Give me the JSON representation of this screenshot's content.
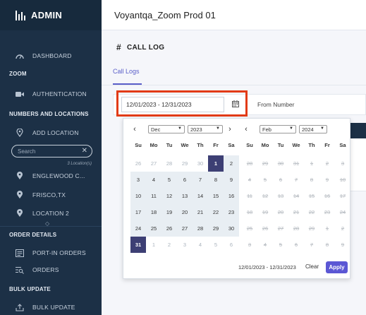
{
  "sidebar": {
    "brand": "ADMIN",
    "items": [
      {
        "label": "DASHBOARD",
        "icon": "gauge-icon"
      },
      {
        "label": "AUTHENTICATION",
        "icon": "video-icon"
      },
      {
        "label": "ADD LOCATION",
        "icon": "map-pin-icon"
      },
      {
        "label": "ENGLEWOOD C...",
        "icon": "map-pin-icon"
      },
      {
        "label": "FRISCO,TX",
        "icon": "map-pin-icon"
      },
      {
        "label": "LOCATION 2",
        "icon": "map-pin-icon"
      },
      {
        "label": "PORT-IN ORDERS",
        "icon": "list-icon"
      },
      {
        "label": "ORDERS",
        "icon": "search-list-icon"
      },
      {
        "label": "BULK UPDATE",
        "icon": "upload-icon"
      }
    ],
    "sections": {
      "zoom": "ZOOM",
      "numbers": "NUMBERS AND LOCATIONS",
      "order_details": "ORDER DETAILS",
      "bulk_update": "BULK UPDATE"
    },
    "search": {
      "placeholder": "Search"
    },
    "location_count": "3 Location(s)"
  },
  "header": {
    "title": "Voyantqa_Zoom Prod 01"
  },
  "page": {
    "title": "CALL LOG",
    "tab": "Call Logs",
    "date_range_value": "12/01/2023 - 12/31/2023",
    "from_number_label": "From Number"
  },
  "picker": {
    "weekdays": [
      "Su",
      "Mo",
      "Tu",
      "We",
      "Th",
      "Fr",
      "Sa"
    ],
    "left": {
      "month": "Dec",
      "year": "2023",
      "weeks": [
        [
          "26",
          "27",
          "28",
          "29",
          "30",
          "1",
          "2"
        ],
        [
          "3",
          "4",
          "5",
          "6",
          "7",
          "8",
          "9"
        ],
        [
          "10",
          "11",
          "12",
          "13",
          "14",
          "15",
          "16"
        ],
        [
          "17",
          "18",
          "19",
          "20",
          "21",
          "22",
          "23"
        ],
        [
          "24",
          "25",
          "26",
          "27",
          "28",
          "29",
          "30"
        ],
        [
          "31",
          "1",
          "2",
          "3",
          "4",
          "5",
          "6"
        ]
      ]
    },
    "right": {
      "month": "Feb",
      "year": "2024",
      "weeks": [
        [
          "28",
          "29",
          "30",
          "31",
          "1",
          "2",
          "3"
        ],
        [
          "4",
          "5",
          "6",
          "7",
          "8",
          "9",
          "10"
        ],
        [
          "11",
          "12",
          "13",
          "14",
          "15",
          "16",
          "17"
        ],
        [
          "18",
          "19",
          "20",
          "21",
          "22",
          "23",
          "24"
        ],
        [
          "25",
          "26",
          "27",
          "28",
          "29",
          "1",
          "2"
        ],
        [
          "3",
          "4",
          "5",
          "6",
          "7",
          "8",
          "9"
        ]
      ]
    },
    "footer_range": "12/01/2023 - 12/31/2023",
    "clear_label": "Clear",
    "apply_label": "Apply"
  },
  "colors": {
    "sidebar_bg": "#1c3046",
    "accent": "#5b57d4",
    "selected_day": "#3d3f74",
    "highlight_box": "#e23b17"
  }
}
